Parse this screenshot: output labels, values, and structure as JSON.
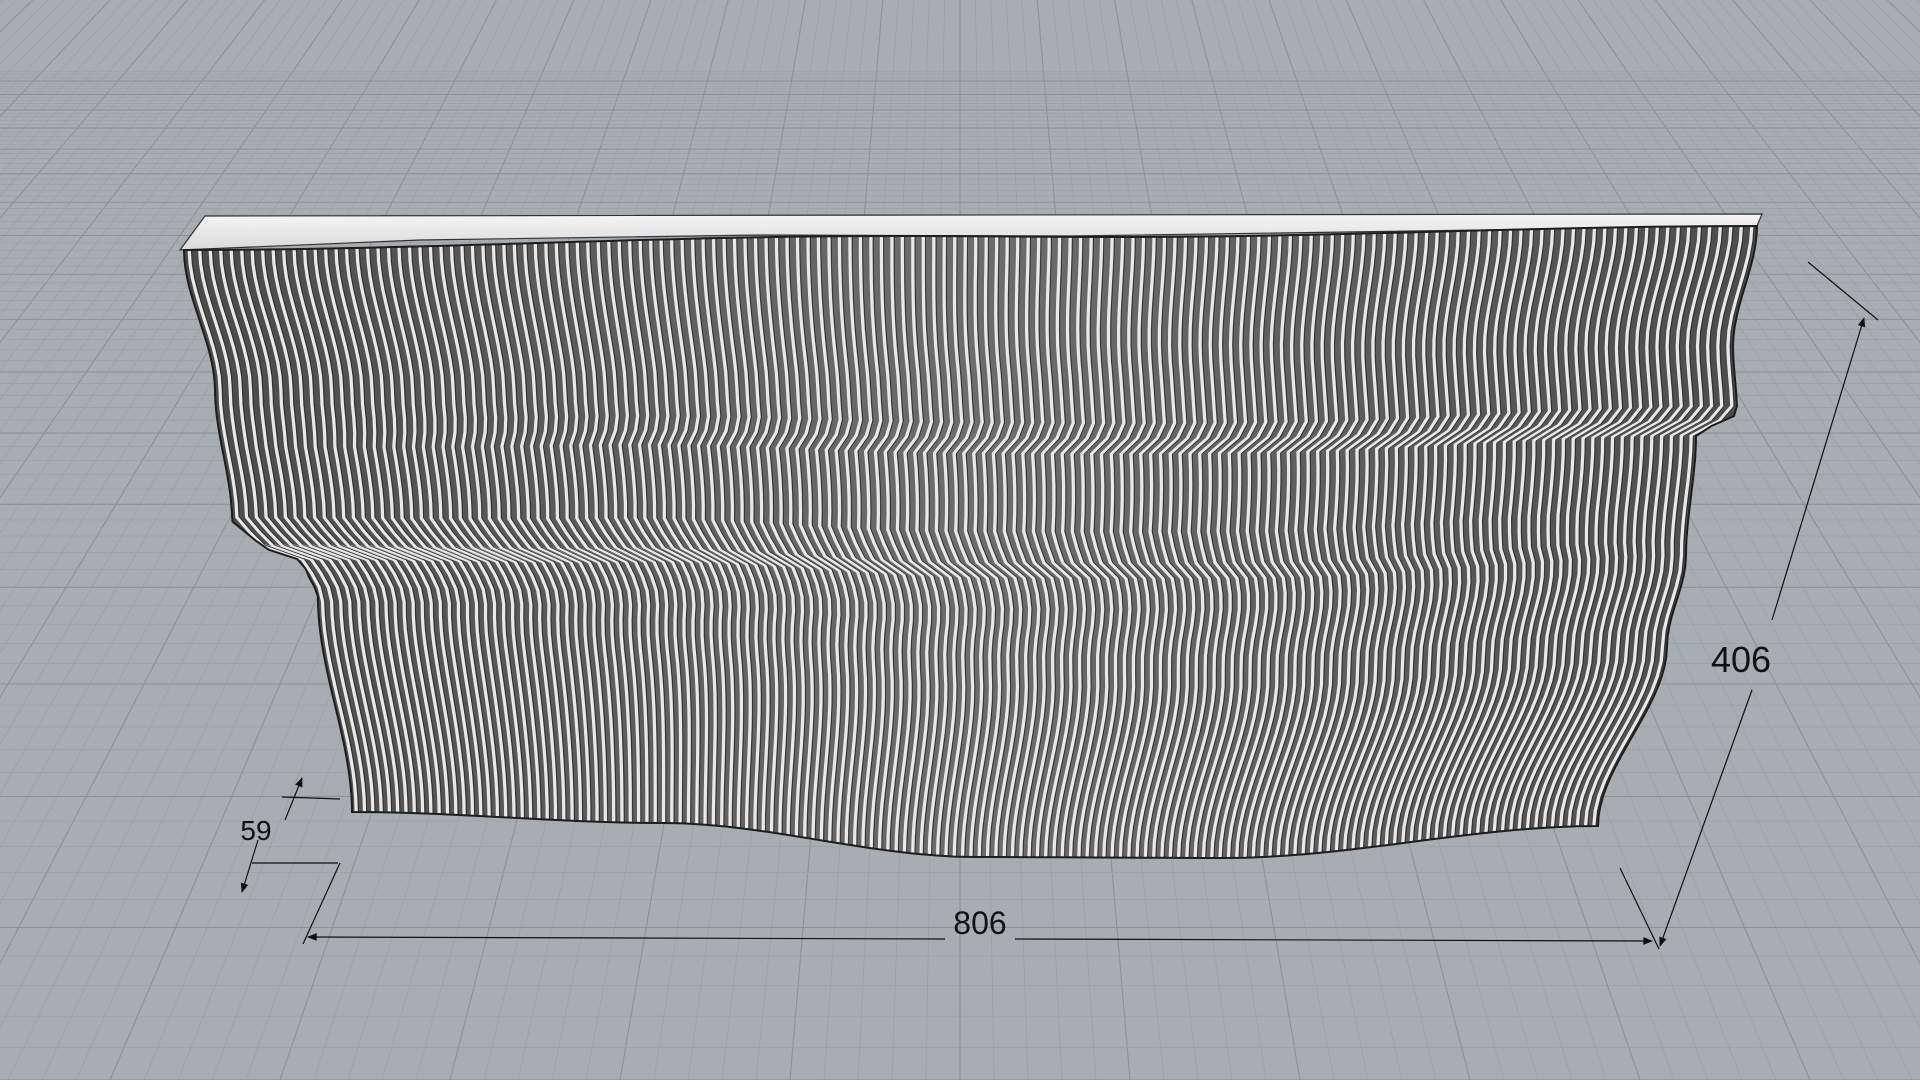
{
  "viewport": {
    "background_color": "#a7adb3",
    "grid_minor_color": "#98a0a8",
    "grid_major_color": "#8a929b",
    "object_fill_color": "#5f5f5f",
    "slat_color": "#e9e9e9",
    "top_face_color": "#f2f2f2",
    "dimension_color": "#111111"
  },
  "panel": {
    "slat_count": 150
  },
  "dimensions": {
    "width": "806",
    "height": "406",
    "depth": "59"
  }
}
